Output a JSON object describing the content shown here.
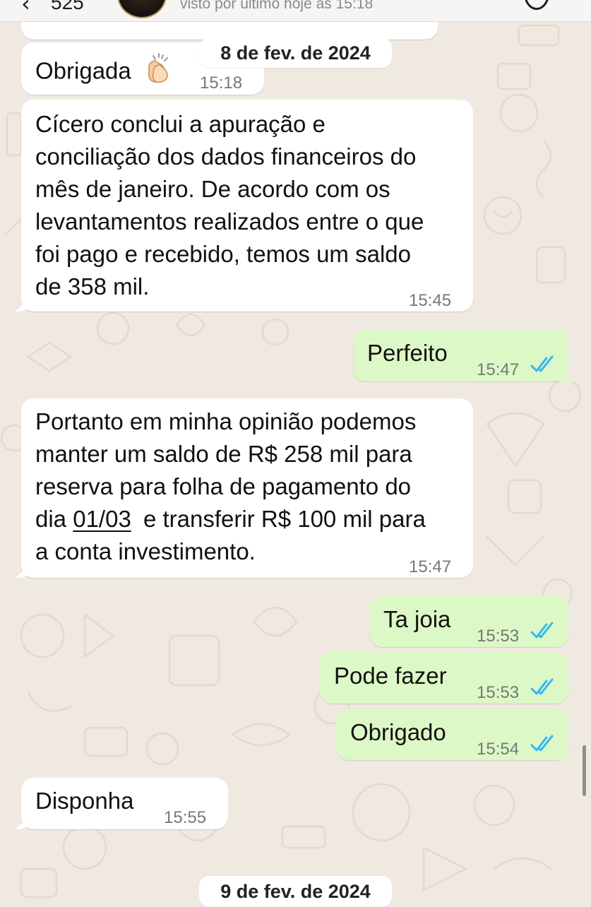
{
  "header": {
    "contact_name": "525",
    "last_seen": "visto por último hoje às 15:18"
  },
  "dates": {
    "first": "8 de fev. de 2024",
    "second": "9 de fev. de 2024"
  },
  "messages": [
    {
      "direction": "in",
      "text": "Obrigada",
      "emoji": "clapping-hands",
      "time": "15:18"
    },
    {
      "direction": "in",
      "lines": [
        "Cícero conclui a apuração e",
        "conciliação dos dados financeiros do",
        "mês de janeiro. De acordo com os",
        "levantamentos realizados entre o que",
        "foi pago e recebido, temos um saldo",
        "de 358 mil."
      ],
      "time": "15:45"
    },
    {
      "direction": "out",
      "text": "Perfeito",
      "time": "15:47",
      "status": "read"
    },
    {
      "direction": "in",
      "lines": [
        "Portanto em minha opinião podemos",
        "manter um saldo de R$ 258 mil para",
        "reserva para folha de pagamento do",
        "dia",
        "01/03",
        "e transferir R$ 100 mil para",
        "a conta investimento."
      ],
      "time": "15:47"
    },
    {
      "direction": "out",
      "text": "Ta joia",
      "time": "15:53",
      "status": "read"
    },
    {
      "direction": "out",
      "text": "Pode fazer",
      "time": "15:53",
      "status": "read"
    },
    {
      "direction": "out",
      "text": "Obrigado",
      "time": "15:54",
      "status": "read"
    },
    {
      "direction": "in",
      "text": "Disponha",
      "time": "15:55"
    }
  ],
  "colors": {
    "incoming_bubble": "#ffffff",
    "outgoing_bubble": "#dcf8c6",
    "read_ticks": "#34b7f1",
    "wallpaper": "#efe9e1"
  }
}
